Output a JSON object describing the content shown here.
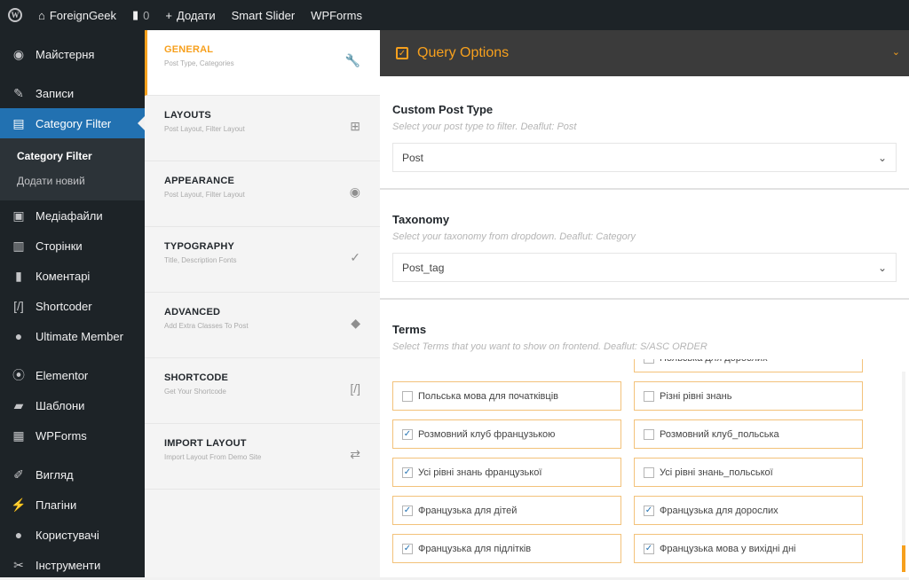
{
  "adminbar": {
    "site_name": "ForeignGeek",
    "comments_count": "0",
    "add_new": "Додати",
    "smart_slider": "Smart Slider",
    "wpforms": "WPForms"
  },
  "sidebar": {
    "dashboard": "Майстерня",
    "posts": "Записи",
    "category_filter": "Category Filter",
    "sub_category_filter": "Category Filter",
    "sub_add_new": "Додати новий",
    "media": "Медіафайли",
    "pages": "Сторінки",
    "comments": "Коментарі",
    "shortcoder": "Shortcoder",
    "ultimate_member": "Ultimate Member",
    "elementor": "Elementor",
    "templates": "Шаблони",
    "wpforms": "WPForms",
    "appearance": "Вигляд",
    "plugins": "Плагіни",
    "users": "Користувачі",
    "tools": "Інструменти"
  },
  "tabs": [
    {
      "title": "GENERAL",
      "subtitle": "Post Type, Categories"
    },
    {
      "title": "LAYOUTS",
      "subtitle": "Post Layout, Filter Layout"
    },
    {
      "title": "APPEARANCE",
      "subtitle": "Post Layout, Filter Layout"
    },
    {
      "title": "TYPOGRAPHY",
      "subtitle": "Title, Description Fonts"
    },
    {
      "title": "ADVANCED",
      "subtitle": "Add Extra Classes To Post"
    },
    {
      "title": "SHORTCODE",
      "subtitle": "Get Your Shortcode"
    },
    {
      "title": "IMPORT LAYOUT",
      "subtitle": "Import Layout From Demo Site"
    }
  ],
  "query": {
    "header": "Query Options",
    "post_type_label": "Custom Post Type",
    "post_type_desc": "Select your post type to filter. Deaflut: Post",
    "post_type_value": "Post",
    "taxonomy_label": "Taxonomy",
    "taxonomy_desc": "Select your taxonomy from dropdown. Deaflut: Category",
    "taxonomy_value": "Post_tag",
    "terms_label": "Terms",
    "terms_desc": "Select Terms that you want to show on frontend. Deaflut: S/ASC ORDER"
  },
  "terms": [
    {
      "label": "",
      "checked": false
    },
    {
      "label": "Польська для дорослих",
      "checked": false
    },
    {
      "label": "Польська мова для початківців",
      "checked": false
    },
    {
      "label": "Різні рівні знань",
      "checked": false
    },
    {
      "label": "Розмовний клуб французькою",
      "checked": true
    },
    {
      "label": "Розмовний клуб_польська",
      "checked": false
    },
    {
      "label": "Усі рівні знань французької",
      "checked": true
    },
    {
      "label": "Усі рівні знань_польської",
      "checked": false
    },
    {
      "label": "Французька для дітей",
      "checked": true
    },
    {
      "label": "Французька для дорослих",
      "checked": true
    },
    {
      "label": "Французька для підлітків",
      "checked": true
    },
    {
      "label": "Французька мова у вихідні дні",
      "checked": true
    }
  ]
}
